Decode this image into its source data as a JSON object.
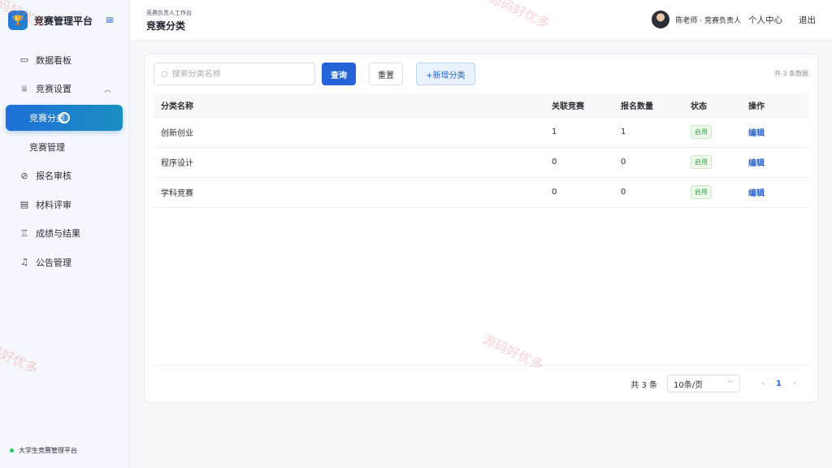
{
  "sidebar": {
    "brand": "竞赛管理平台",
    "items": [
      {
        "label": "数据看板",
        "icon": "chart-board-icon"
      },
      {
        "label": "竞赛设置",
        "icon": "trophy-icon"
      },
      {
        "label": "竞赛分类"
      },
      {
        "label": "竞赛管理"
      },
      {
        "label": "报名审核",
        "icon": "check-circle-icon"
      },
      {
        "label": "材料评审",
        "icon": "document-icon"
      },
      {
        "label": "成绩与结果",
        "icon": "medal-icon"
      },
      {
        "label": "公告管理",
        "icon": "bell-icon"
      }
    ],
    "footer": "大学生竞赛管理平台"
  },
  "header": {
    "crumb": "竞赛负责人工作台",
    "title": "竞赛分类",
    "user": "陈老师 · 竞赛负责人",
    "profile": "个人中心",
    "logout": "退出"
  },
  "toolbar": {
    "search_placeholder": "搜索分类名称",
    "query": "查询",
    "reset": "重置",
    "add": "+新增分类",
    "count": "共 3 条数据"
  },
  "table": {
    "columns": [
      "分类名称",
      "关联竞赛",
      "报名数量",
      "状态",
      "操作"
    ],
    "rows": [
      {
        "name": "创新创业",
        "linked": "1",
        "signups": "1",
        "status": "启用",
        "action": "编辑"
      },
      {
        "name": "程序设计",
        "linked": "0",
        "signups": "0",
        "status": "启用",
        "action": "编辑"
      },
      {
        "name": "学科竞赛",
        "linked": "0",
        "signups": "0",
        "status": "启用",
        "action": "编辑"
      }
    ]
  },
  "pager": {
    "total": "共 3 条",
    "size": "10条/页",
    "page": "1"
  },
  "watermark": "源码好优多"
}
